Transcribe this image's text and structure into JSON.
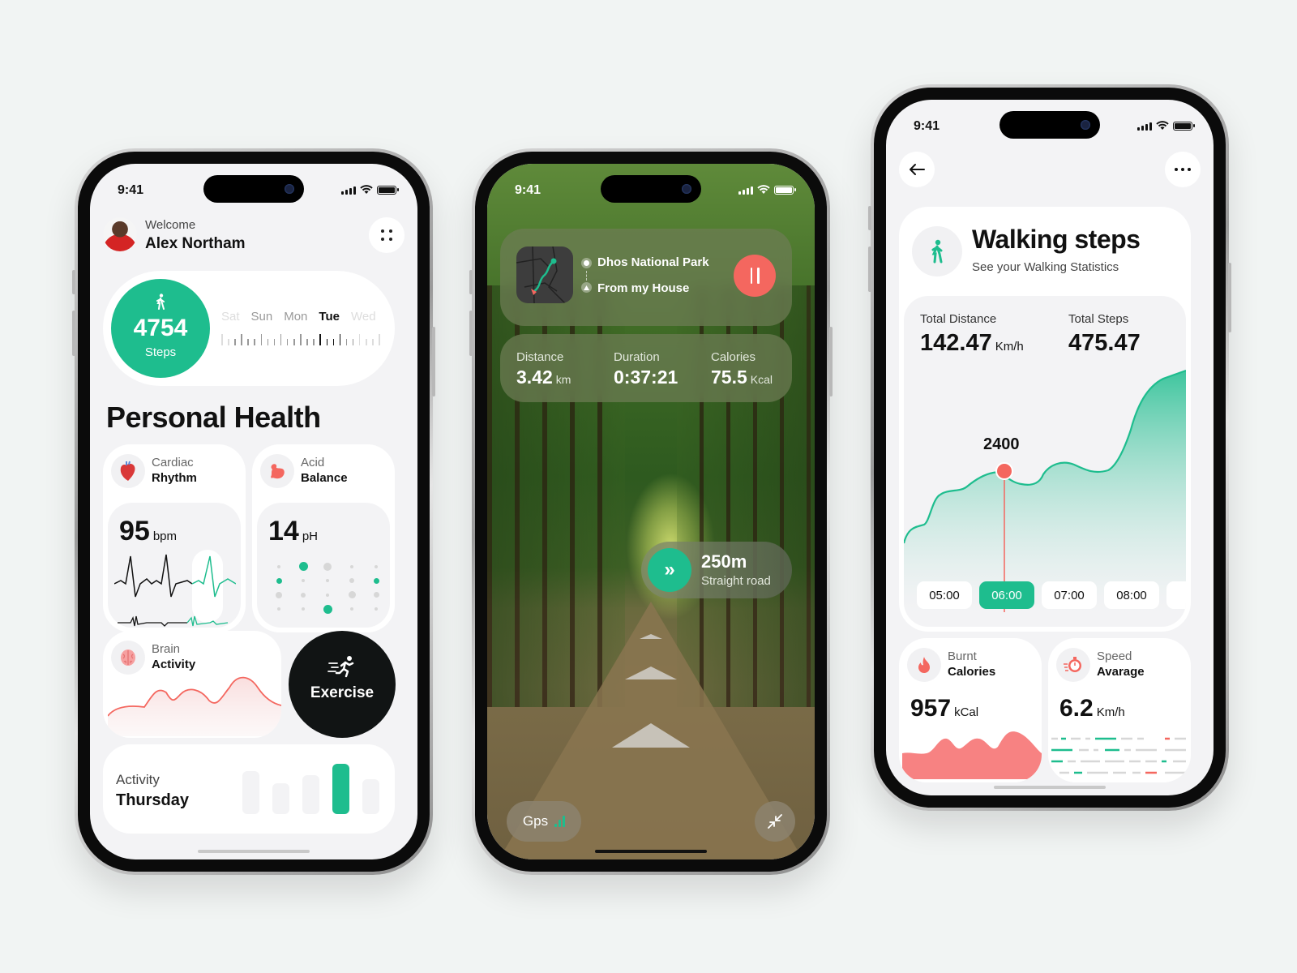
{
  "colors": {
    "accent": "#1ebd8e",
    "alert": "#f4675f",
    "dark": "#111414",
    "background": "#f1f4f3"
  },
  "phone1": {
    "status": {
      "time": "9:41"
    },
    "header": {
      "welcome": "Welcome",
      "name": "Alex Northam",
      "menu_icon": "grid-dots-icon"
    },
    "steps": {
      "count": "4754",
      "label": "Steps",
      "icon": "walking-icon",
      "days": [
        "Sat",
        "Sun",
        "Mon",
        "Tue",
        "Wed"
      ],
      "selected_day": "Tue"
    },
    "title": "Personal Health",
    "cardiac": {
      "label_light": "Cardiac",
      "label_bold": "Rhythm",
      "value": "95",
      "unit": "bpm",
      "icon": "heart-icon"
    },
    "acid": {
      "label_light": "Acid",
      "label_bold": "Balance",
      "value": "14",
      "unit": "pH",
      "icon": "stomach-icon"
    },
    "brain": {
      "label_light": "Brain",
      "label_bold": "Activity",
      "icon": "brain-icon"
    },
    "exercise": {
      "label": "Exercise",
      "icon": "running-icon"
    },
    "activity": {
      "label_light": "Activity",
      "label_bold": "Thursday",
      "bars": [
        0.85,
        0.62,
        0.78,
        1.0,
        0.7
      ],
      "highlight_index": 3
    }
  },
  "phone2": {
    "status": {
      "time": "9:41"
    },
    "route": {
      "destination": "Dhos National Park",
      "origin": "From my House",
      "pause_icon": "pause-icon"
    },
    "stats": [
      {
        "label": "Distance",
        "value": "3.42",
        "unit": "km"
      },
      {
        "label": "Duration",
        "value": "0:37:21",
        "unit": ""
      },
      {
        "label": "Calories",
        "value": "75.5",
        "unit": "Kcal"
      }
    ],
    "navigation": {
      "distance": "250m",
      "instruction": "Straight road",
      "icon": "double-chevron-right-icon"
    },
    "gps": {
      "label": "Gps"
    }
  },
  "phone3": {
    "status": {
      "time": "9:41"
    },
    "title": "Walking steps",
    "subtitle": "See your Walking Statistics",
    "totals": {
      "distance_label": "Total Distance",
      "distance_value": "142.47",
      "distance_unit": "Km/h",
      "steps_label": "Total Steps",
      "steps_value": "475.47"
    },
    "chart": {
      "highlight_value": "2400",
      "times": [
        "05:00",
        "06:00",
        "07:00",
        "08:00"
      ],
      "selected_time": "06:00"
    },
    "calories": {
      "label_light": "Burnt",
      "label_bold": "Calories",
      "value": "957",
      "unit": "kCal",
      "icon": "flame-icon"
    },
    "speed": {
      "label_light": "Speed",
      "label_bold": "Avarage",
      "value": "6.2",
      "unit": "Km/h",
      "icon": "stopwatch-icon"
    }
  }
}
